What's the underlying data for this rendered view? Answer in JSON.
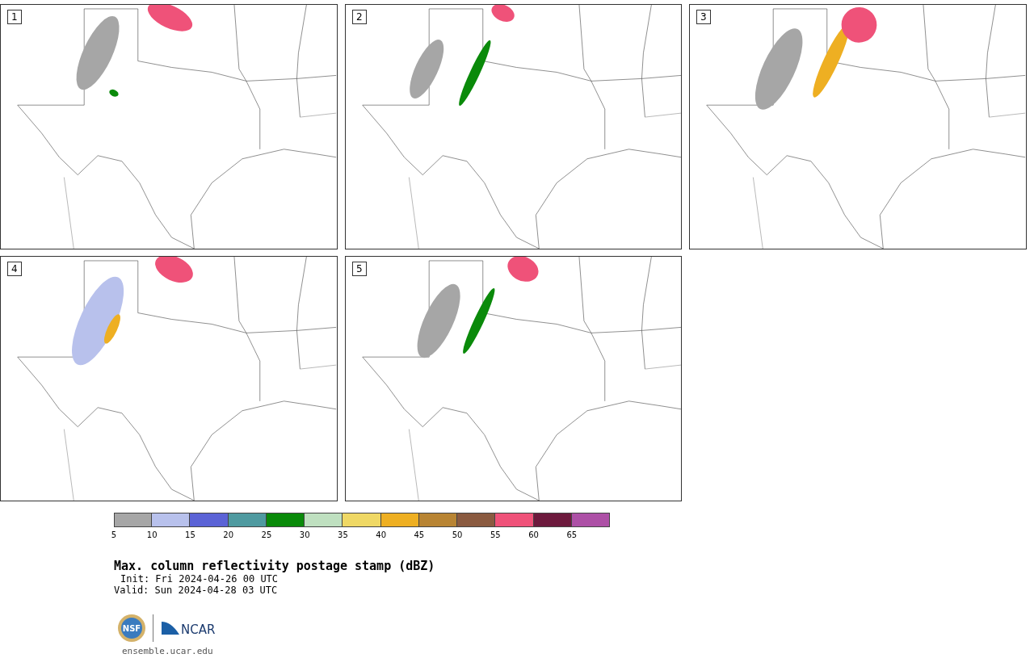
{
  "panels": [
    {
      "label": "1"
    },
    {
      "label": "2"
    },
    {
      "label": "3"
    },
    {
      "label": "4"
    },
    {
      "label": "5"
    }
  ],
  "colorbar": {
    "bins": [
      {
        "color": "#a6a6a6"
      },
      {
        "color": "#b8c1ec"
      },
      {
        "color": "#5b63d6"
      },
      {
        "color": "#4f9aa0"
      },
      {
        "color": "#0a8a0a"
      },
      {
        "color": "#bfe0c0"
      },
      {
        "color": "#efd865"
      },
      {
        "color": "#eeaf22"
      },
      {
        "color": "#b88433"
      },
      {
        "color": "#8a5a40"
      },
      {
        "color": "#ef5279"
      },
      {
        "color": "#6d1a3d"
      },
      {
        "color": "#ad50a6"
      }
    ],
    "ticks": [
      "5",
      "10",
      "15",
      "20",
      "25",
      "30",
      "35",
      "40",
      "45",
      "50",
      "55",
      "60",
      "65"
    ]
  },
  "title": "Max. column reflectivity postage stamp (dBZ)",
  "init": "Init: Fri 2024-04-26 00 UTC",
  "valid": "Valid: Sun 2024-04-28 03 UTC",
  "logos": {
    "nsf": "NSF",
    "ncar": "NCAR"
  },
  "url": "ensemble.ucar.edu"
}
